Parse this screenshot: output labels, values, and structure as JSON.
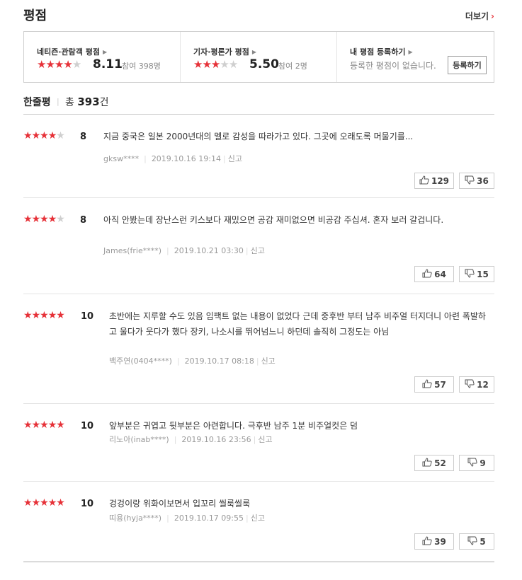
{
  "header": {
    "title": "평점",
    "more_label": "더보기",
    "more_chevron": "›"
  },
  "summary": {
    "audience": {
      "label": "네티즌·관람객 평점",
      "filled_stars": 4,
      "total_stars": 5,
      "score": "8.11",
      "participants": "참여 398명"
    },
    "critics": {
      "label": "기자·평론가 평점",
      "filled_stars": 3,
      "total_stars": 5,
      "score": "5.50",
      "participants": "참여 2명"
    },
    "mine": {
      "label": "내 평점 등록하기",
      "message": "등록한 평점이 없습니다.",
      "register_button": "등록하기"
    }
  },
  "list": {
    "title": "한줄평",
    "total_prefix": "총",
    "total_count": "393",
    "total_suffix": "건"
  },
  "colors": {
    "accent": "#e63138",
    "star_off": "#cfcfcf",
    "border": "#cfcfcf"
  },
  "icons": {
    "like": "thumbs-up-icon",
    "dislike": "thumbs-down-icon"
  },
  "reviews": [
    {
      "filled_stars": 4,
      "score": "8",
      "text": "지금 중국은 일본 2000년대의 멜로 감성을 따라가고 있다. 그곳에 오래도록 머물기를...",
      "author": "gksw****",
      "date": "2019.10.16 19:14",
      "report": "신고",
      "likes": "129",
      "dislikes": "36"
    },
    {
      "filled_stars": 4,
      "score": "8",
      "text": "아직 안봤는데 장난스런 키스보다 재밌으면 공감 재미없으면 비공감 주십셔. 혼자 보러 갈겁니다.",
      "author": "James(frie****)",
      "date": "2019.10.21 03:30",
      "report": "신고",
      "likes": "64",
      "dislikes": "15"
    },
    {
      "filled_stars": 5,
      "score": "10",
      "text": "초반에는 지루할 수도 있음 임팩트 없는 내용이 없었다 근데 중후반 부터 남주 비주얼 터지더니 아련 폭발하고 울다가 웃다가 했다 장키, 나소시를 뛰어넘느니 하던데 솔직히 그정도는 아님",
      "author": "백주연(0404****)",
      "date": "2019.10.17 08:18",
      "report": "신고",
      "likes": "57",
      "dislikes": "12"
    },
    {
      "filled_stars": 5,
      "score": "10",
      "text": "앞부분은 귀엽고 뒷부분은 아련합니다. 극후반 남주 1분 비주얼컷은 덤",
      "author": "리노아(inab****)",
      "date": "2019.10.16 23:56",
      "report": "신고",
      "likes": "52",
      "dislikes": "9"
    },
    {
      "filled_stars": 5,
      "score": "10",
      "text": "겅겅이랑 위화이보면서 입꼬리 씰룩씰룩",
      "author": "띠용(hyja****)",
      "date": "2019.10.17 09:55",
      "report": "신고",
      "likes": "39",
      "dislikes": "5"
    }
  ]
}
